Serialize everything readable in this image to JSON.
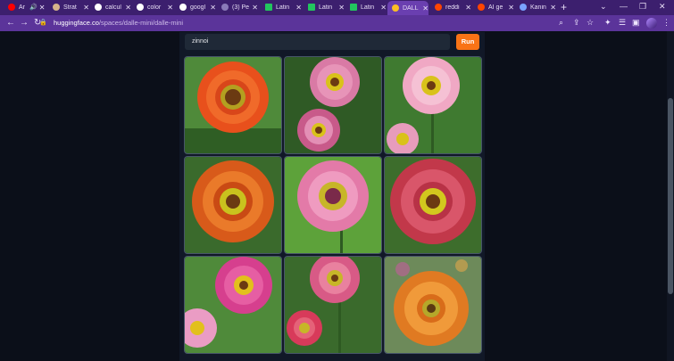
{
  "tabs": [
    {
      "title": "Ar",
      "favicon_color": "#ff0000",
      "favicon": "youtube-icon",
      "active": false,
      "audio": true
    },
    {
      "title": "Strat",
      "favicon_color": "#d6b48a",
      "favicon": "page-icon",
      "active": false
    },
    {
      "title": "calcul",
      "favicon_color": "#ffffff",
      "favicon": "google-icon",
      "active": false
    },
    {
      "title": "color",
      "favicon_color": "#ffffff",
      "favicon": "google-icon",
      "active": false
    },
    {
      "title": "googl",
      "favicon_color": "#ffffff",
      "favicon": "google-icon",
      "active": false
    },
    {
      "title": "(3) Pe",
      "favicon_color": "#8a7ab8",
      "favicon": "page-icon",
      "active": false
    },
    {
      "title": "Latin",
      "favicon_color": "#22c55e",
      "favicon": "l-icon",
      "active": false
    },
    {
      "title": "Latin",
      "favicon_color": "#22c55e",
      "favicon": "l-icon",
      "active": false
    },
    {
      "title": "Latin",
      "favicon_color": "#22c55e",
      "favicon": "l-icon",
      "active": false
    },
    {
      "title": "DALL",
      "favicon_color": "#fbbf24",
      "favicon": "hugging-face-icon",
      "active": true
    },
    {
      "title": "reddi",
      "favicon_color": "#ff4500",
      "favicon": "reddit-icon",
      "active": false
    },
    {
      "title": "AI ge",
      "favicon_color": "#ff4500",
      "favicon": "reddit-icon",
      "active": false
    },
    {
      "title": "Kanin",
      "favicon_color": "#7aa2ff",
      "favicon": "page-icon",
      "active": false
    }
  ],
  "address": {
    "host": "huggingface.co",
    "path": "/spaces/dalle-mini/dalle-mini"
  },
  "prompt": {
    "value": "zinnoi"
  },
  "run_label": "Run",
  "colors": {
    "accent": "#f97316",
    "panel": "#111827"
  },
  "images": [
    {
      "description": "orange zinnia close-up"
    },
    {
      "description": "pink zinnias pair"
    },
    {
      "description": "light pink zinnias"
    },
    {
      "description": "orange zinnia"
    },
    {
      "description": "pink zinnia on green"
    },
    {
      "description": "red zinnia"
    },
    {
      "description": "magenta zinnias"
    },
    {
      "description": "pink zinnias on stems"
    },
    {
      "description": "orange zinnia with bokeh"
    }
  ]
}
